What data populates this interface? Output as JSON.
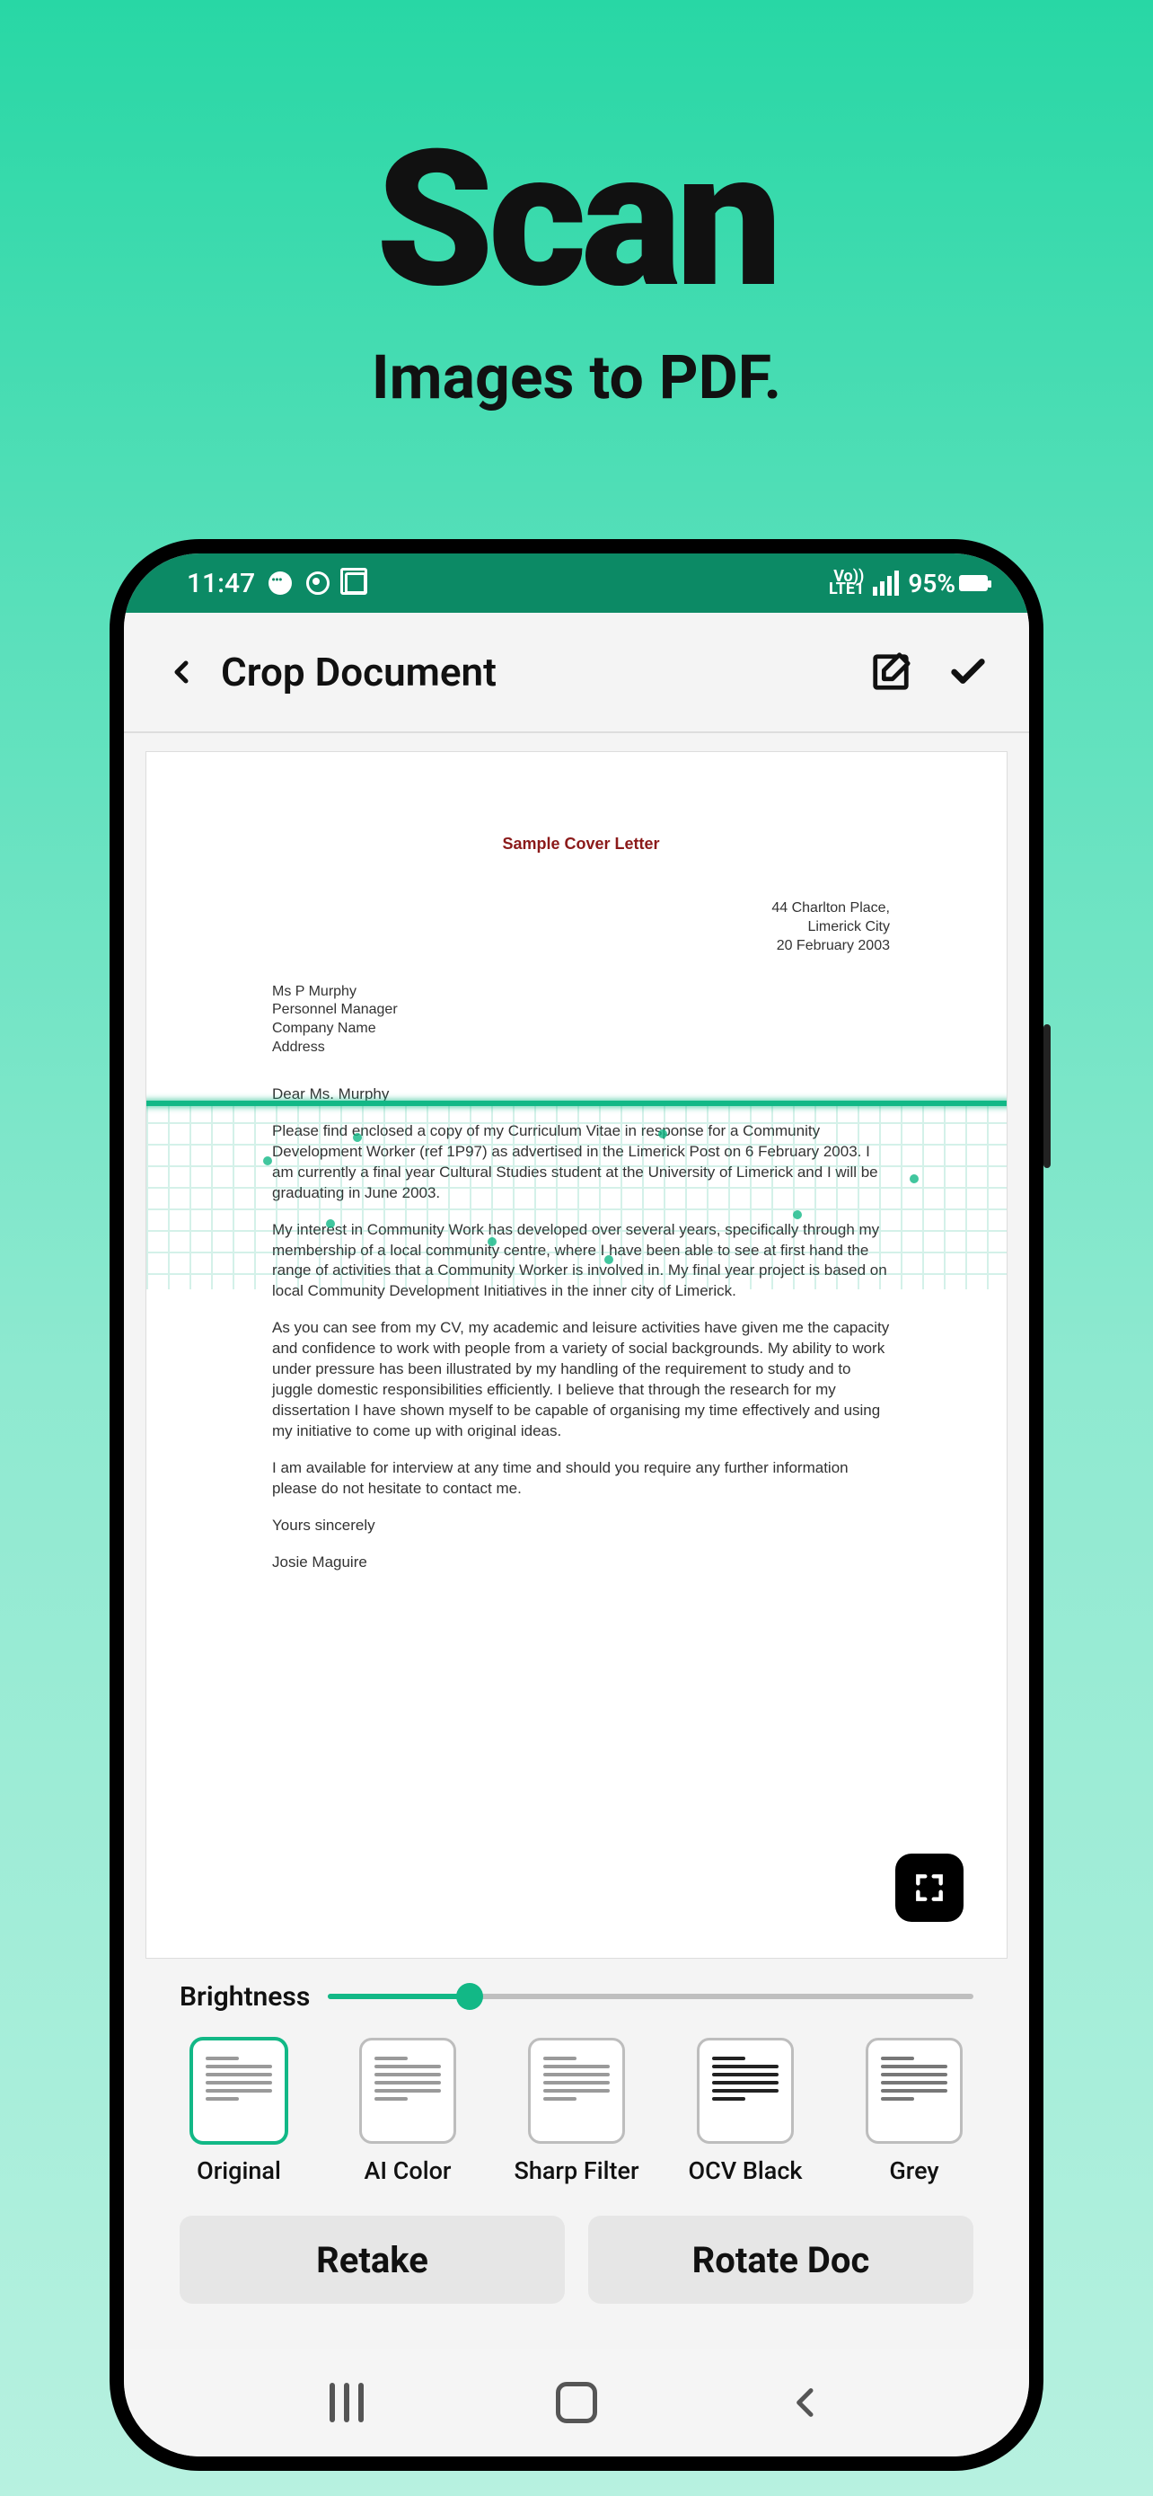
{
  "promo": {
    "title": "Scan",
    "subtitle": "Images to PDF."
  },
  "statusbar": {
    "time": "11:47",
    "network_label": "Vo))\nLTE1",
    "battery_text": "95%"
  },
  "header": {
    "title": "Crop Document"
  },
  "document": {
    "title": "Sample Cover Letter",
    "address_right_1": "44 Charlton Place,",
    "address_right_2": "Limerick City",
    "address_right_3": "20 February 2003",
    "address_left_1": "Ms P Murphy",
    "address_left_2": "Personnel Manager",
    "address_left_3": "Company Name",
    "address_left_4": "Address",
    "salutation": "Dear Ms. Murphy",
    "p1": "Please find enclosed a copy of my Curriculum Vitae in response for a Community Development Worker (ref 1P97) as advertised in the Limerick Post on 6 February 2003.  I am currently a final year Cultural Studies student at the University of Limerick and I will be graduating in June 2003.",
    "p2": "My interest in Community Work has developed over several years, specifically through my membership of a local community centre, where I have been able to see at first hand the range of activities that a Community Worker is involved in.  My final year project is based on local Community Development Initiatives in the inner city of Limerick.",
    "p3": "As you can see from my CV, my academic and leisure activities have given me the capacity and confidence to work with people from a variety of social backgrounds. My ability to work under pressure has been illustrated by my handling of the requirement to study and to juggle domestic responsibilities efficiently. I believe that through the research for my dissertation I have shown myself to be capable of organising my time effectively and using my initiative to come up with original ideas.",
    "p4": "I am available for interview at any time and should you require any further information please do not hesitate to contact me.",
    "closing": "Yours sincerely",
    "signature": "Josie Maguire"
  },
  "brightness": {
    "label": "Brightness",
    "value": 22
  },
  "filters": [
    {
      "label": "Original",
      "selected": true
    },
    {
      "label": "AI Color",
      "selected": false
    },
    {
      "label": "Sharp Filter",
      "selected": false
    },
    {
      "label": "OCV Black",
      "selected": false
    },
    {
      "label": "Grey",
      "selected": false
    }
  ],
  "buttons": {
    "retake": "Retake",
    "rotate": "Rotate Doc"
  }
}
